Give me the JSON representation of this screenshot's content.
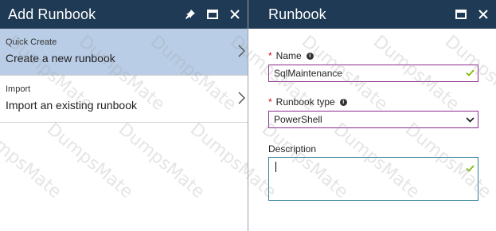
{
  "left_blade": {
    "title": "Add Runbook",
    "items": [
      {
        "caption": "Quick Create",
        "text": "Create a new runbook",
        "selected": true
      },
      {
        "caption": "Import",
        "text": "Import an existing runbook",
        "selected": false
      }
    ]
  },
  "right_blade": {
    "title": "Runbook",
    "name_label": "Name",
    "name_value": "SqlMaintenance",
    "type_label": "Runbook type",
    "type_value": "PowerShell",
    "description_label": "Description",
    "description_value": ""
  },
  "watermark": "DumpsMate",
  "colors": {
    "header_bg": "#1f3a54",
    "selected_bg": "#b9cde6",
    "required": "#d0021b",
    "valid_check": "#7fba00",
    "field_border": "#8d2d8d"
  },
  "icons": [
    "pin-icon",
    "maximize-icon",
    "close-icon",
    "chevron-right-icon",
    "info-icon",
    "checkmark-icon",
    "chevron-down-icon"
  ]
}
